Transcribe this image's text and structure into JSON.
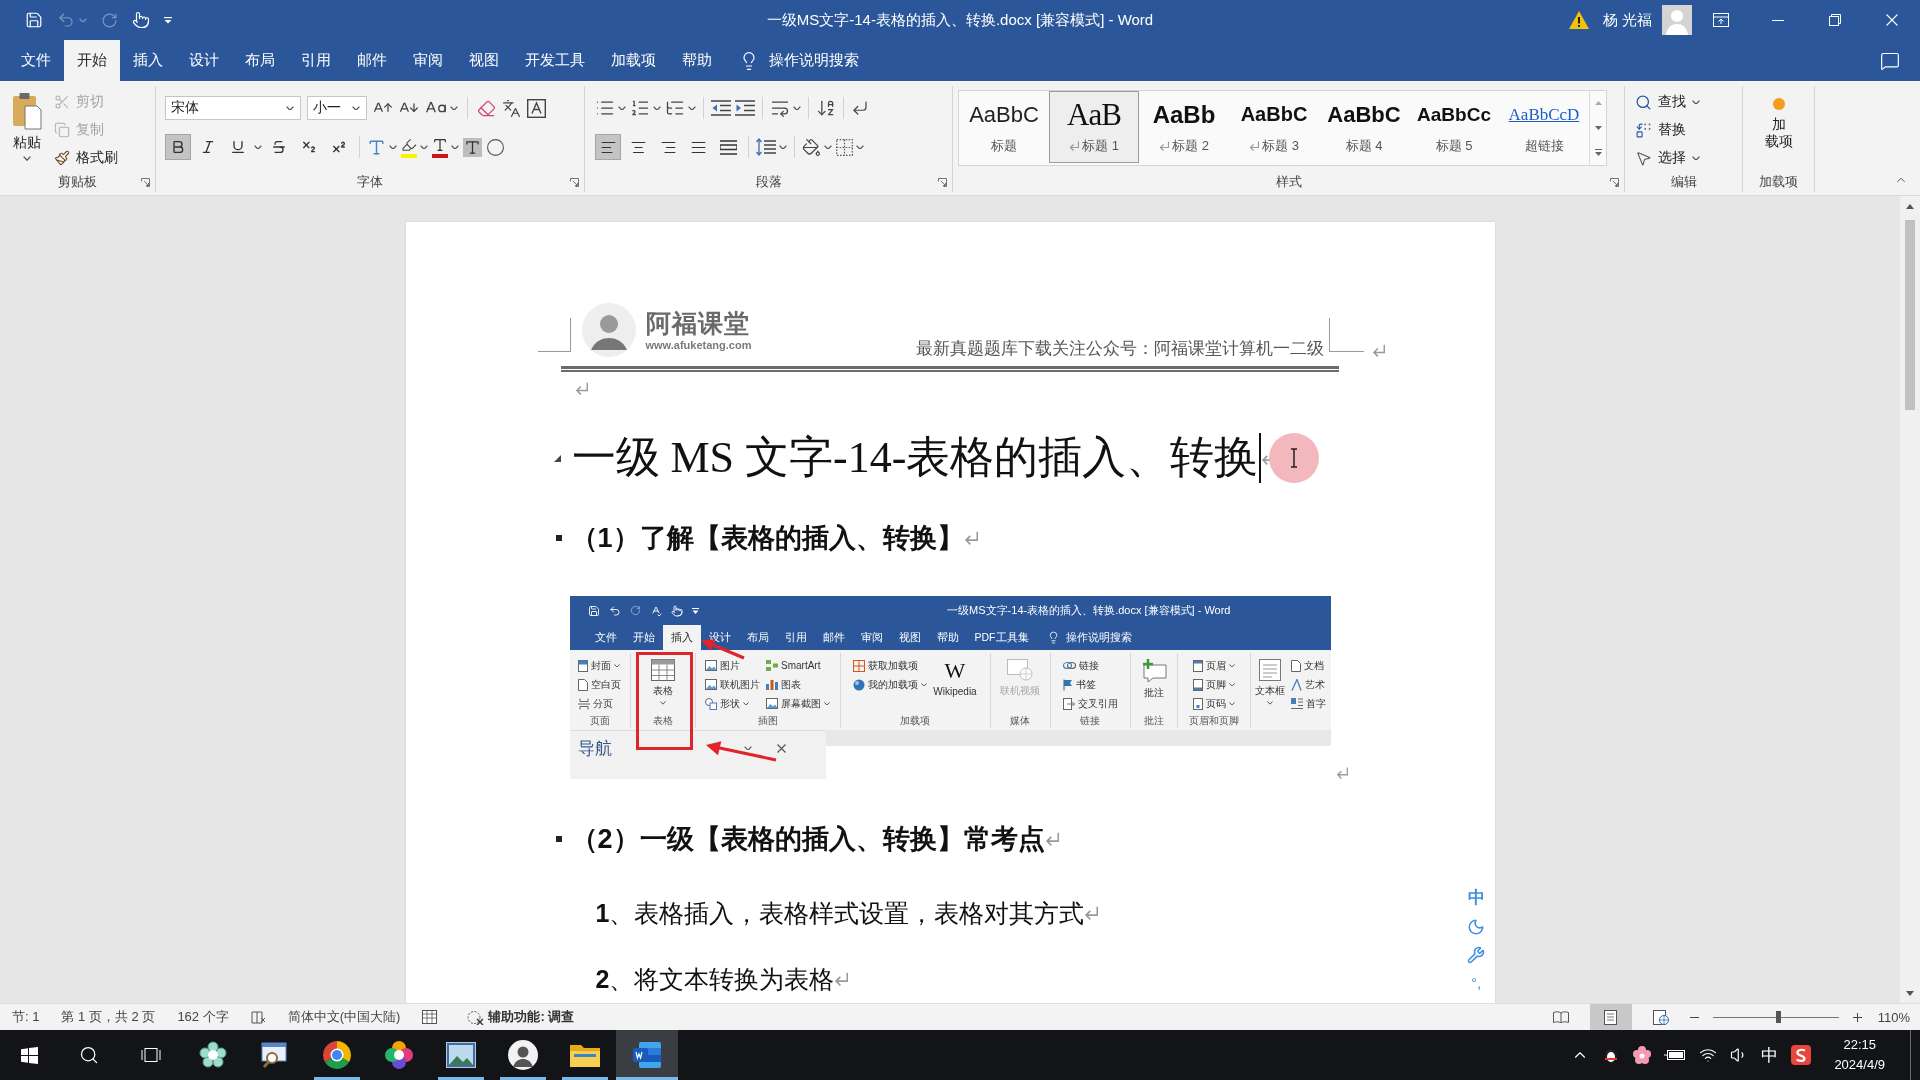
{
  "window": {
    "title": "一级MS文字-14-表格的插入、转换.docx [兼容模式] - Word",
    "user": "杨 光福"
  },
  "quick_access": [
    {
      "kind": "save",
      "disabled": false
    },
    {
      "kind": "undo",
      "disabled": true
    },
    {
      "kind": "repeat",
      "disabled": true
    },
    {
      "kind": "touch",
      "disabled": false
    },
    {
      "kind": "customize",
      "disabled": false
    }
  ],
  "tabs": [
    {
      "label": "文件",
      "selected": false
    },
    {
      "label": "开始",
      "selected": true
    },
    {
      "label": "插入",
      "selected": false
    },
    {
      "label": "设计",
      "selected": false
    },
    {
      "label": "布局",
      "selected": false
    },
    {
      "label": "引用",
      "selected": false
    },
    {
      "label": "邮件",
      "selected": false
    },
    {
      "label": "审阅",
      "selected": false
    },
    {
      "label": "视图",
      "selected": false
    },
    {
      "label": "开发工具",
      "selected": false
    },
    {
      "label": "加载项",
      "selected": false
    },
    {
      "label": "帮助",
      "selected": false
    }
  ],
  "tell_me": "操作说明搜索",
  "clipboard": {
    "paste": "粘贴",
    "items": [
      {
        "kind": "cut",
        "label": "剪切",
        "disabled": true
      },
      {
        "kind": "copy",
        "label": "复制",
        "disabled": true
      },
      {
        "kind": "painter",
        "label": "格式刷",
        "disabled": false
      }
    ],
    "group": "剪贴板"
  },
  "font": {
    "name": "宋体",
    "size": "小一",
    "formats": [
      {
        "kind": "bold",
        "selected": true
      },
      {
        "kind": "italic",
        "selected": false
      },
      {
        "kind": "underline",
        "selected": false
      },
      {
        "kind": "strike",
        "selected": false
      },
      {
        "kind": "subscript",
        "selected": false
      },
      {
        "kind": "superscript",
        "selected": false
      }
    ],
    "group": "字体"
  },
  "paragraph": {
    "align": [
      {
        "kind": "left",
        "selected": true
      },
      {
        "kind": "center",
        "selected": false
      },
      {
        "kind": "right",
        "selected": false
      },
      {
        "kind": "justify",
        "selected": false
      },
      {
        "kind": "distributed",
        "selected": false
      }
    ],
    "group": "段落"
  },
  "styles": {
    "items": [
      {
        "kind": "title",
        "preview": "AaBbC",
        "name": "标题",
        "linked": false,
        "selected": false
      },
      {
        "kind": "heading1",
        "preview": "AaB",
        "name": "标题 1",
        "linked": true,
        "selected": true
      },
      {
        "kind": "heading2",
        "preview": "AaBb",
        "name": "标题 2",
        "linked": true,
        "selected": false
      },
      {
        "kind": "heading3",
        "preview": "AaBbC",
        "name": "标题 3",
        "linked": true,
        "selected": false
      },
      {
        "kind": "heading4",
        "preview": "AaBbC",
        "name": "标题 4",
        "linked": false,
        "selected": false
      },
      {
        "kind": "heading5",
        "preview": "AaBbCc",
        "name": "标题 5",
        "linked": false,
        "selected": false
      },
      {
        "kind": "hyperlink",
        "preview": "AaBbCcD",
        "name": "超链接",
        "linked": false,
        "selected": false
      }
    ],
    "group": "样式"
  },
  "editing": {
    "items": [
      {
        "kind": "find",
        "label": "查找"
      },
      {
        "kind": "replace",
        "label": "替换"
      },
      {
        "kind": "select",
        "label": "选择"
      }
    ],
    "group": "编辑"
  },
  "addins": {
    "button": [
      "加",
      "载项"
    ],
    "group": "加载项"
  },
  "document": {
    "header": {
      "logo_title": "阿福课堂",
      "logo_url": "www.afuketang.com",
      "notice": "最新真题题库下载关注公众号：阿福课堂计算机一二级"
    },
    "blocks": [
      {
        "kind": "empty"
      },
      {
        "kind": "title",
        "text": "一级 MS 文字-14-表格的插入、转换",
        "caret": true
      },
      {
        "kind": "heading",
        "text": "（1）了解【表格的插入、转换】"
      },
      {
        "kind": "figure",
        "title": "一级MS文字-14-表格的插入、转换.docx [兼容模式] - Word",
        "tabs": [
          {
            "label": "文件",
            "selected": false
          },
          {
            "label": "开始",
            "selected": false
          },
          {
            "label": "插入",
            "selected": true
          },
          {
            "label": "设计",
            "selected": false
          },
          {
            "label": "布局",
            "selected": false
          },
          {
            "label": "引用",
            "selected": false
          },
          {
            "label": "邮件",
            "selected": false
          },
          {
            "label": "审阅",
            "selected": false
          },
          {
            "label": "视图",
            "selected": false
          },
          {
            "label": "帮助",
            "selected": false
          },
          {
            "label": "PDF工具集",
            "selected": false
          }
        ],
        "tell_me": "操作说明搜索",
        "groups": [
          {
            "label": "页面",
            "tools": [
              {
                "kind": "cover",
                "label": "封面",
                "dropdown": true,
                "disabled": false
              },
              {
                "kind": "blank",
                "label": "空白页",
                "dropdown": false,
                "disabled": false
              },
              {
                "kind": "break",
                "label": "分页",
                "dropdown": false,
                "disabled": false
              }
            ]
          },
          {
            "label": "表格",
            "tools": [
              {
                "kind": "table",
                "label": "表格",
                "dropdown": true,
                "disabled": false
              }
            ]
          },
          {
            "label": "插图",
            "tools": [
              {
                "kind": "picture",
                "label": "图片",
                "dropdown": false,
                "disabled": false
              },
              {
                "kind": "online_picture",
                "label": "联机图片",
                "dropdown": false,
                "disabled": false
              },
              {
                "kind": "shapes",
                "label": "形状",
                "dropdown": true,
                "disabled": false
              },
              {
                "kind": "smartart",
                "label": "SmartArt",
                "dropdown": false,
                "disabled": false
              },
              {
                "kind": "chart",
                "label": "图表",
                "dropdown": false,
                "disabled": false
              },
              {
                "kind": "screenshot",
                "label": "屏幕截图",
                "dropdown": true,
                "disabled": false
              }
            ]
          },
          {
            "label": "加载项",
            "tools": [
              {
                "kind": "get_addins",
                "label": "获取加载项",
                "dropdown": false,
                "disabled": false
              },
              {
                "kind": "my_addins",
                "label": "我的加载项",
                "dropdown": true,
                "disabled": false
              },
              {
                "kind": "wiki",
                "glyph": "W",
                "label": "Wikipedia",
                "dropdown": false,
                "disabled": false
              }
            ]
          },
          {
            "label": "媒体",
            "tools": [
              {
                "kind": "video",
                "label": "联机视频",
                "dropdown": false,
                "disabled": true
              }
            ]
          },
          {
            "label": "链接",
            "tools": [
              {
                "kind": "link",
                "label": "链接",
                "dropdown": false,
                "disabled": false
              },
              {
                "kind": "bookmark",
                "label": "书签",
                "dropdown": false,
                "disabled": false
              },
              {
                "kind": "crossref",
                "label": "交叉引用",
                "dropdown": false,
                "disabled": false
              }
            ]
          },
          {
            "label": "批注",
            "tools": [
              {
                "kind": "comment",
                "label": "批注",
                "dropdown": false,
                "disabled": false
              }
            ]
          },
          {
            "label": "页眉和页脚",
            "tools": [
              {
                "kind": "header",
                "label": "页眉",
                "dropdown": true,
                "disabled": false
              },
              {
                "kind": "footer",
                "label": "页脚",
                "dropdown": true,
                "disabled": false
              },
              {
                "kind": "page_number",
                "label": "页码",
                "dropdown": true,
                "disabled": false
              }
            ]
          },
          {
            "tools": [
              {
                "kind": "textbox",
                "label": "文本框",
                "dropdown": true,
                "disabled": false
              },
              {
                "kind": "quickparts",
                "label": "文档",
                "dropdown": false,
                "disabled": false
              },
              {
                "kind": "wordart",
                "label": "艺术",
                "dropdown": false,
                "disabled": false
              },
              {
                "kind": "dropcap",
                "label": "首字",
                "dropdown": false,
                "disabled": false
              }
            ]
          }
        ],
        "nav_title": "导航"
      },
      {
        "kind": "heading",
        "text": "（2）一级【表格的插入、转换】常考点"
      },
      {
        "kind": "item",
        "text": "**1**、表格插入，表格样式设置，表格对其方式"
      },
      {
        "kind": "item",
        "text": "**2**、将文本转换为表格"
      }
    ]
  },
  "ime_toolbar": {
    "mode": "中",
    "punctuation": "°,"
  },
  "status_bar": {
    "section": "节: 1",
    "page": "第 1 页，共 2 页",
    "words": "162 个字",
    "language": "简体中文(中国大陆)",
    "accessibility": "辅助功能: 调查",
    "views": [
      {
        "kind": "read",
        "selected": false
      },
      {
        "kind": "print",
        "selected": true
      },
      {
        "kind": "web",
        "selected": false
      }
    ],
    "zoom": {
      "level": 0.52,
      "reading": "110%"
    }
  },
  "taskbar": {
    "apps": [
      {
        "kind": "flower",
        "running": false,
        "active": false
      },
      {
        "kind": "magnifier",
        "running": false,
        "active": false
      },
      {
        "kind": "tricolor",
        "running": true,
        "active": false
      },
      {
        "kind": "colorwheel",
        "running": false,
        "active": false
      },
      {
        "kind": "photos",
        "running": true,
        "active": false
      },
      {
        "kind": "avatar",
        "running": true,
        "active": false
      },
      {
        "kind": "folder",
        "running": true,
        "active": false
      },
      {
        "kind": "document",
        "running": true,
        "active": true
      }
    ],
    "ime": "中",
    "time": "22:15",
    "date": "2024/4/9"
  }
}
